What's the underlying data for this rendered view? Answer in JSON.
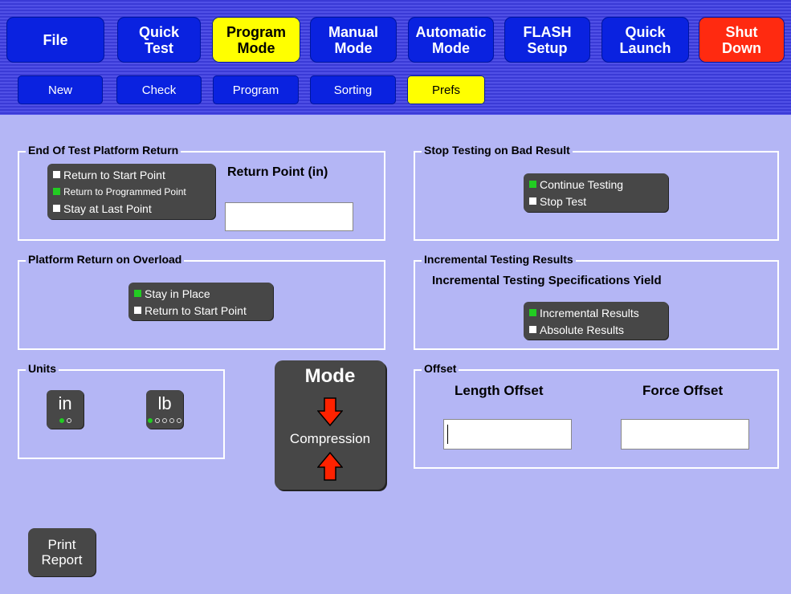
{
  "nav": {
    "file": "File",
    "quick_test": "Quick\nTest",
    "program_mode": "Program\nMode",
    "manual_mode": "Manual\nMode",
    "automatic_mode": "Automatic\nMode",
    "flash_setup": "FLASH\nSetup",
    "quick_launch": "Quick\nLaunch",
    "shut_down": "Shut\nDown"
  },
  "subnav": {
    "new": "New",
    "check": "Check",
    "program": "Program",
    "sorting": "Sorting",
    "prefs": "Prefs"
  },
  "end_of_test": {
    "title": "End Of Test Platform Return",
    "options": [
      "Return to Start Point",
      "Return to Programmed Point",
      "Stay at Last Point"
    ],
    "selected": "Return to Programmed Point",
    "return_point_label": "Return Point (in)",
    "return_point_value": ""
  },
  "stop_testing": {
    "title": "Stop Testing on Bad Result",
    "options": [
      "Continue Testing",
      "Stop Test"
    ],
    "selected": "Continue Testing"
  },
  "overload": {
    "title": "Platform Return on Overload",
    "options": [
      "Stay in Place",
      "Return to Start Point"
    ],
    "selected": "Stay in Place"
  },
  "incremental": {
    "title": "Incremental Testing Results",
    "subtitle": "Incremental Testing Specifications Yield",
    "options": [
      "Incremental Results",
      "Absolute Results"
    ],
    "selected": "Incremental Results"
  },
  "units": {
    "title": "Units",
    "length_unit": "in",
    "force_unit": "lb"
  },
  "mode": {
    "title": "Mode",
    "value": "Compression",
    "arrow_color": "#ff2200"
  },
  "offset": {
    "title": "Offset",
    "length_label": "Length Offset",
    "force_label": "Force Offset",
    "length_value": "",
    "force_value": ""
  },
  "print_report": "Print\nReport",
  "colors": {
    "accent_blue": "#0a22e0",
    "active_yellow": "#ffff00",
    "danger_red": "#ff2a10",
    "selected_green": "#22cc22",
    "background": "#b4b6f5"
  }
}
